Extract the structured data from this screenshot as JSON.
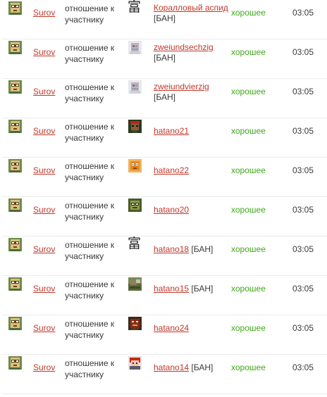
{
  "relation_text": "отношение к участнику",
  "rows": [
    {
      "author": "Surov",
      "relation": "отношение к участнику",
      "target": "Коралловый аспид",
      "ban": "[БАН]",
      "status": "хорошее",
      "time": "03:05",
      "target_icon": "kanji-glyph-icon",
      "glyph": "富"
    },
    {
      "author": "Surov",
      "relation": "отношение к участнику",
      "target": "zweiundsechzig",
      "ban": "[БАН]",
      "status": "хорошее",
      "time": "03:05",
      "target_icon": "grey-avatar-icon"
    },
    {
      "author": "Surov",
      "relation": "отношение к участнику",
      "target": "zweiundvierzig",
      "ban": "[БАН]",
      "status": "хорошее",
      "time": "03:05",
      "target_icon": "grey-avatar-icon"
    },
    {
      "author": "Surov",
      "relation": "отношение к участнику",
      "target": "hatano21",
      "ban": "",
      "status": "хорошее",
      "time": "03:05",
      "target_icon": "red-bandana-avatar-icon"
    },
    {
      "author": "Surov",
      "relation": "отношение к участнику",
      "target": "hatano22",
      "ban": "",
      "status": "хорошее",
      "time": "03:05",
      "target_icon": "orange-face-avatar-icon"
    },
    {
      "author": "Surov",
      "relation": "отношение к участнику",
      "target": "hatano20",
      "ban": "",
      "status": "хорошее",
      "time": "03:05",
      "target_icon": "glasses-avatar-icon"
    },
    {
      "author": "Surov",
      "relation": "отношение к участнику",
      "target": "hatano18",
      "ban": "[БАН]",
      "status": "хорошее",
      "time": "03:05",
      "target_icon": "kanji-glyph-icon",
      "glyph": "富"
    },
    {
      "author": "Surov",
      "relation": "отношение к участнику",
      "target": "hatano15",
      "ban": "[БАН]",
      "status": "хорошее",
      "time": "03:05",
      "target_icon": "landscape-avatar-icon"
    },
    {
      "author": "Surov",
      "relation": "отношение к участнику",
      "target": "hatano24",
      "ban": "",
      "status": "хорошее",
      "time": "03:05",
      "target_icon": "dark-red-avatar-icon"
    },
    {
      "author": "Surov",
      "relation": "отношение к участнику",
      "target": "hatano14",
      "ban": "[БАН]",
      "status": "хорошее",
      "time": "03:05",
      "target_icon": "red-hair-avatar-icon"
    }
  ],
  "colors": {
    "link": "#c0392b",
    "good": "#3fa81a",
    "text": "#3a3a3a"
  }
}
